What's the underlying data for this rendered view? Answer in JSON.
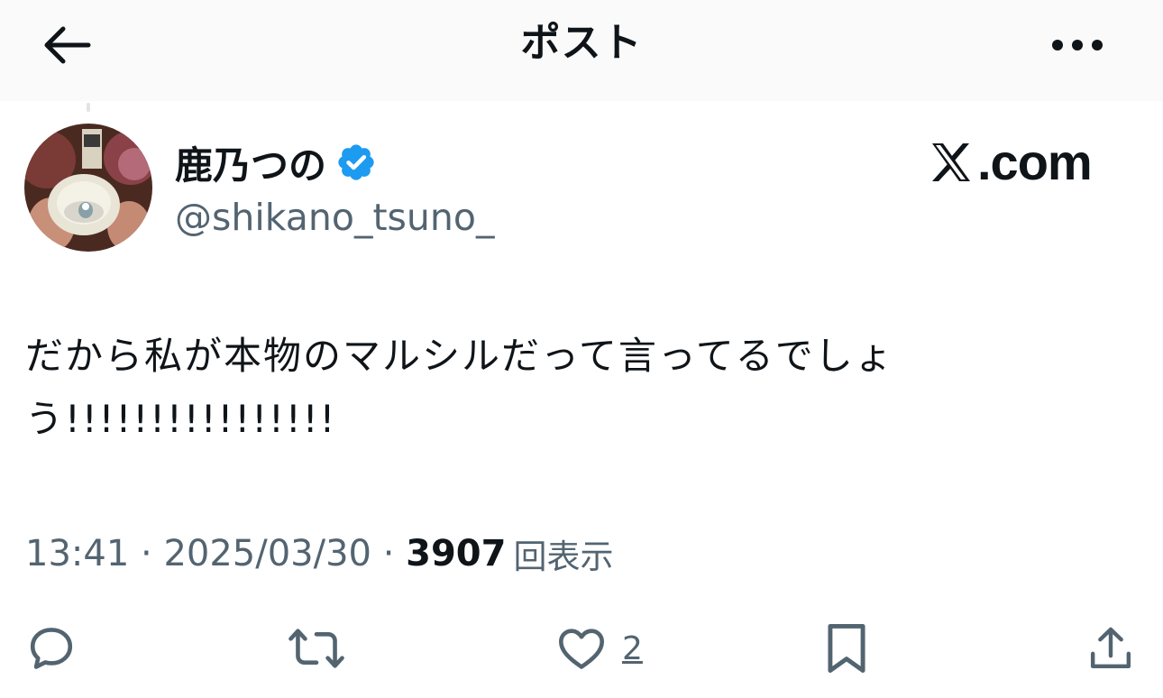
{
  "header": {
    "title": "ポスト",
    "back_icon": "arrow-left-icon",
    "more_icon": "more-horizontal-icon"
  },
  "author": {
    "display_name": "鹿乃つの",
    "handle": "@shikano_tsuno_",
    "verified": true,
    "verified_color": "#1d9bf0"
  },
  "watermark": {
    "text": ".com",
    "logo_icon": "x-logo-icon"
  },
  "tweet": {
    "text": "だから私が本物のマルシルだって言ってるでしょ\nう!!!!!!!!!!!!!!!!"
  },
  "meta": {
    "time": "13:41",
    "separator": " · ",
    "date": "2025/03/30",
    "view_count": "3907",
    "view_label": "回表示"
  },
  "actions": {
    "reply_icon": "reply-icon",
    "repost_icon": "repost-icon",
    "like_icon": "heart-icon",
    "like_count": "2",
    "bookmark_icon": "bookmark-icon",
    "share_icon": "share-icon"
  },
  "colors": {
    "text_primary": "#0f1419",
    "text_secondary": "#536471",
    "header_bg": "#fafafa",
    "icon_gray": "#536471"
  }
}
